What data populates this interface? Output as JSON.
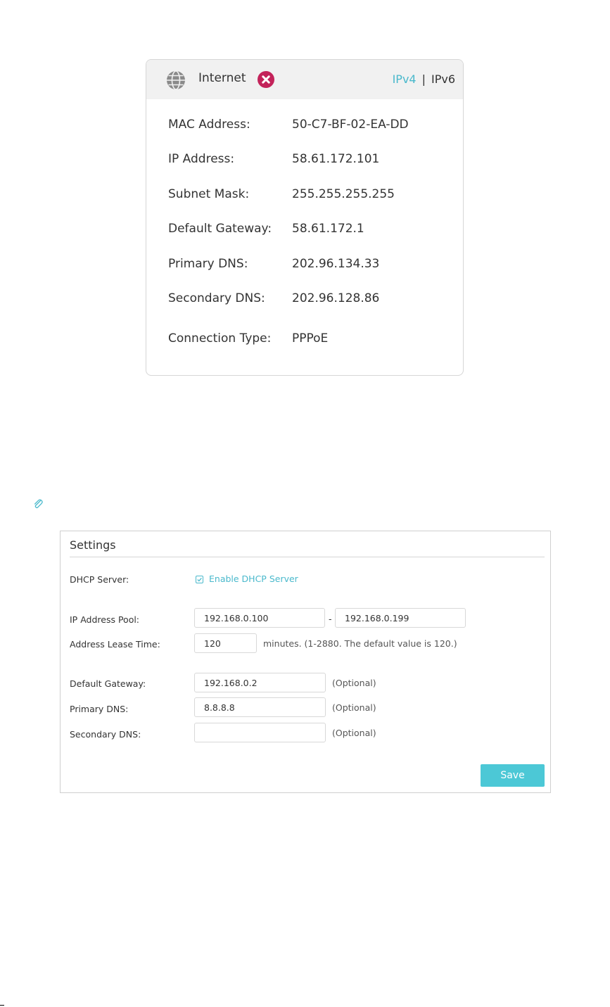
{
  "internet": {
    "title": "Internet",
    "status": "disconnected",
    "ipv4_label": "IPv4",
    "separator": "|",
    "ipv6_label": "IPv6",
    "active_tab": "IPv4",
    "rows": [
      {
        "label": "MAC Address:",
        "value": "50-C7-BF-02-EA-DD"
      },
      {
        "label": "IP Address:",
        "value": "58.61.172.101"
      },
      {
        "label": "Subnet Mask:",
        "value": "255.255.255.255"
      },
      {
        "label": "Default Gateway:",
        "value": "58.61.172.1"
      },
      {
        "label": "Primary DNS:",
        "value": "202.96.134.33"
      },
      {
        "label": "Secondary DNS:",
        "value": "202.96.128.86"
      },
      {
        "label": "Connection Type:",
        "value": "PPPoE"
      }
    ]
  },
  "note_icon": "paperclip-icon",
  "settings": {
    "title": "Settings",
    "dhcp_server_label": "DHCP Server:",
    "dhcp_enable_label": "Enable DHCP Server",
    "dhcp_enabled": true,
    "ip_pool_label": "IP Address Pool:",
    "ip_pool_start": "192.168.0.100",
    "ip_pool_dash": "-",
    "ip_pool_end": "192.168.0.199",
    "lease_label": "Address Lease Time:",
    "lease_value": "120",
    "lease_hint": "minutes. (1-2880. The default value is 120.)",
    "gateway_label": "Default Gateway:",
    "gateway_value": "192.168.0.2",
    "primary_dns_label": "Primary DNS:",
    "primary_dns_value": "8.8.8.8",
    "secondary_dns_label": "Secondary DNS:",
    "secondary_dns_value": "",
    "optional_hint": "(Optional)",
    "save_label": "Save"
  },
  "colors": {
    "accent": "#4ab9cc",
    "save_button": "#4cc8d6",
    "error": "#c3235a"
  }
}
